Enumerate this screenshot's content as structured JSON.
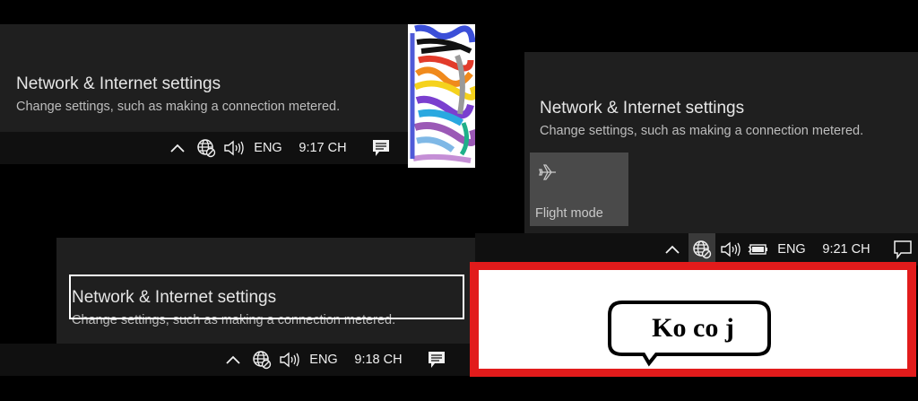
{
  "panels": {
    "top_left": {
      "title": "Network & Internet settings",
      "subtitle": "Change settings, such as making a connection metered.",
      "taskbar": {
        "language": "ENG",
        "time": "9:17 CH"
      }
    },
    "bottom_left": {
      "title": "Network & Internet settings",
      "subtitle": "Change settings, such as making a connection metered.",
      "taskbar": {
        "language": "ENG",
        "time": "9:18 CH"
      }
    },
    "right": {
      "title": "Network & Internet settings",
      "subtitle": "Change settings, such as making a connection metered.",
      "flight_mode_label": "Flight mode",
      "taskbar": {
        "language": "ENG",
        "time": "9:21 CH"
      }
    }
  },
  "annotation": {
    "speech_bubble_text": "Ko co j"
  },
  "icons": {
    "chevron": "chevron-up-icon",
    "network": "globe-network-icon",
    "volume": "volume-icon",
    "battery": "battery-charging-icon",
    "notifications": "action-center-icon",
    "airplane": "airplane-icon"
  },
  "colors": {
    "highlight_red": "#e21b1b",
    "panel_bg": "#1f1f1f",
    "taskbar_bg": "#101010"
  }
}
